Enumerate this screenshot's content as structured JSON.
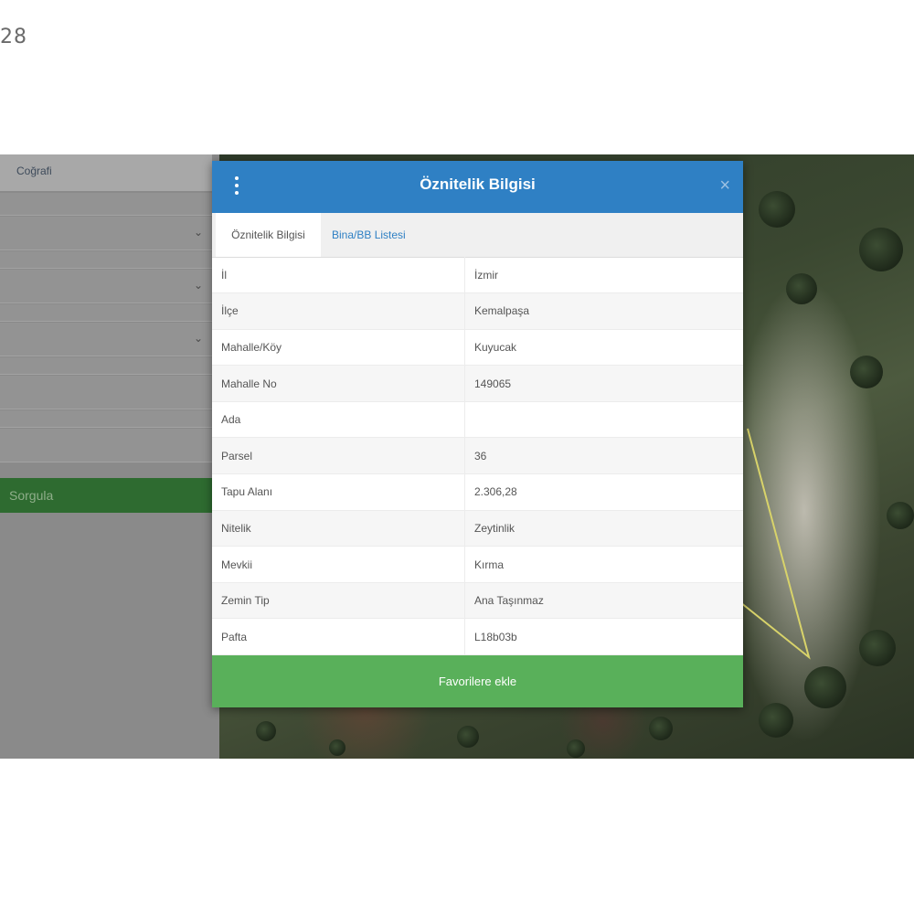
{
  "corner_number": "28",
  "side_panel": {
    "tab_label": "Coğrafi",
    "query_button_label": "Sorgula"
  },
  "modal": {
    "title": "Öznitelik Bilgisi",
    "close_label": "×",
    "tabs": [
      {
        "label": "Öznitelik Bilgisi",
        "active": true
      },
      {
        "label": "Bina/BB Listesi",
        "active": false
      }
    ],
    "rows": [
      {
        "key": "İl",
        "value": "İzmir"
      },
      {
        "key": "İlçe",
        "value": "Kemalpaşa"
      },
      {
        "key": "Mahalle/Köy",
        "value": "Kuyucak"
      },
      {
        "key": "Mahalle No",
        "value": "149065"
      },
      {
        "key": "Ada",
        "value": ""
      },
      {
        "key": "Parsel",
        "value": "36"
      },
      {
        "key": "Tapu Alanı",
        "value": "2.306,28"
      },
      {
        "key": "Nitelik",
        "value": "Zeytinlik"
      },
      {
        "key": "Mevkii",
        "value": "Kırma"
      },
      {
        "key": "Zemin Tip",
        "value": "Ana Taşınmaz"
      },
      {
        "key": "Pafta",
        "value": "L18b03b"
      }
    ],
    "favorites_button_label": "Favorilere ekle"
  },
  "colors": {
    "header_blue": "#2f80c4",
    "favorites_green": "#59b05a",
    "query_green": "#2e6b30",
    "parcel_outline": "#d8d36a"
  },
  "icons": [
    "menu-kebab-icon",
    "close-icon",
    "chevron-down-icon"
  ]
}
